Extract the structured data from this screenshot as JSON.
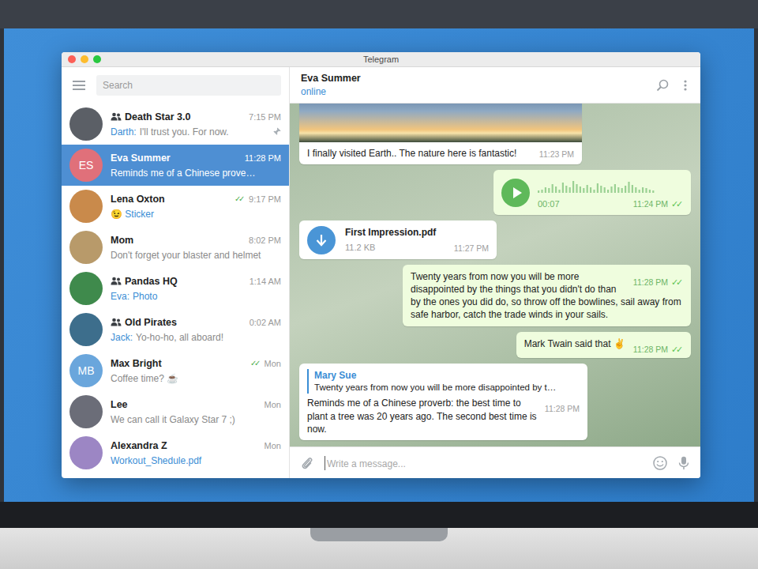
{
  "window": {
    "title": "Telegram"
  },
  "tick_glyph": "✓✓",
  "sidebar": {
    "search_placeholder": "Search",
    "chats": [
      {
        "name": "Death Star 3.0",
        "group": true,
        "time": "7:15 PM",
        "sender": "Darth:",
        "preview": "I'll trust you. For now.",
        "preview_accent": false,
        "read": false,
        "pinned": true,
        "selected": false,
        "avatar": {
          "color": "#5b5f66"
        }
      },
      {
        "name": "Eva Summer",
        "group": false,
        "time": "11:28 PM",
        "sender": "",
        "preview": "Reminds me of a Chinese prove…",
        "preview_accent": false,
        "read": false,
        "pinned": false,
        "selected": true,
        "avatar": {
          "initials": "ES",
          "color": "#e0707a"
        }
      },
      {
        "name": "Lena Oxton",
        "group": false,
        "time": "9:17 PM",
        "sender": "",
        "preview": "😉 Sticker",
        "preview_accent": true,
        "read": true,
        "pinned": false,
        "selected": false,
        "avatar": {
          "color": "#c98a4b"
        }
      },
      {
        "name": "Mom",
        "group": false,
        "time": "8:02 PM",
        "sender": "",
        "preview": "Don't forget your blaster and helmet",
        "preview_accent": false,
        "read": false,
        "pinned": false,
        "selected": false,
        "avatar": {
          "color": "#b89a6a"
        }
      },
      {
        "name": "Pandas HQ",
        "group": true,
        "time": "1:14 AM",
        "sender": "Eva:",
        "preview": "Photo",
        "preview_accent": true,
        "read": false,
        "pinned": false,
        "selected": false,
        "avatar": {
          "color": "#3f8a4c"
        }
      },
      {
        "name": "Old Pirates",
        "group": true,
        "time": "0:02 AM",
        "sender": "Jack:",
        "preview": "Yo-ho-ho, all aboard!",
        "preview_accent": false,
        "read": false,
        "pinned": false,
        "selected": false,
        "avatar": {
          "color": "#3d6e8c"
        }
      },
      {
        "name": "Max Bright",
        "group": false,
        "time": "Mon",
        "sender": "",
        "preview": "Coffee time? ☕",
        "preview_accent": false,
        "read": true,
        "pinned": false,
        "selected": false,
        "avatar": {
          "initials": "MB",
          "color": "#6aa6dc"
        }
      },
      {
        "name": "Lee",
        "group": false,
        "time": "Mon",
        "sender": "",
        "preview": "We can call it Galaxy Star 7 ;)",
        "preview_accent": false,
        "read": false,
        "pinned": false,
        "selected": false,
        "avatar": {
          "color": "#6b6d78"
        }
      },
      {
        "name": "Alexandra Z",
        "group": false,
        "time": "Mon",
        "sender": "",
        "preview": "Workout_Shedule.pdf",
        "preview_accent": true,
        "read": false,
        "pinned": false,
        "selected": false,
        "avatar": {
          "color": "#9c86c4"
        }
      }
    ]
  },
  "chat": {
    "name": "Eva Summer",
    "status": "online",
    "messages": [
      {
        "kind": "photo",
        "outgoing": false,
        "read": false,
        "text": "I finally visited Earth.. The nature here is fantastic!",
        "time": "11:23 PM"
      },
      {
        "kind": "voice",
        "outgoing": true,
        "read": true,
        "duration": "00:07",
        "time": "11:24 PM",
        "waveform": [
          0.15,
          0.2,
          0.3,
          0.25,
          0.5,
          0.35,
          0.2,
          0.6,
          0.4,
          0.3,
          0.7,
          0.5,
          0.35,
          0.25,
          0.45,
          0.3,
          0.2,
          0.55,
          0.4,
          0.3,
          0.2,
          0.35,
          0.5,
          0.3,
          0.25,
          0.4,
          0.65,
          0.45,
          0.3,
          0.2,
          0.3,
          0.25,
          0.2,
          0.15
        ]
      },
      {
        "kind": "file",
        "outgoing": false,
        "read": false,
        "file_name": "First Impression.pdf",
        "size": "11.2 KB",
        "time": "11:27 PM"
      },
      {
        "kind": "text",
        "outgoing": true,
        "read": true,
        "text": "Twenty years from now you will be more disappointed by the things that you didn't do than by the ones you did do, so throw off the bowlines, sail away from safe harbor, catch the trade winds in your sails.",
        "time": "11:28 PM"
      },
      {
        "kind": "text",
        "outgoing": true,
        "read": true,
        "text": "Mark Twain said that ✌",
        "time": "11:28 PM"
      },
      {
        "kind": "reply",
        "outgoing": false,
        "read": false,
        "reply_author": "Mary Sue",
        "reply_text": "Twenty years from now you will be more disappointed by t…",
        "text": "Reminds me of a Chinese proverb: the best time to plant a tree was 20 years ago. The second best time is now.",
        "time": "11:28 PM"
      }
    ],
    "composer": {
      "placeholder": "Write a message..."
    }
  }
}
